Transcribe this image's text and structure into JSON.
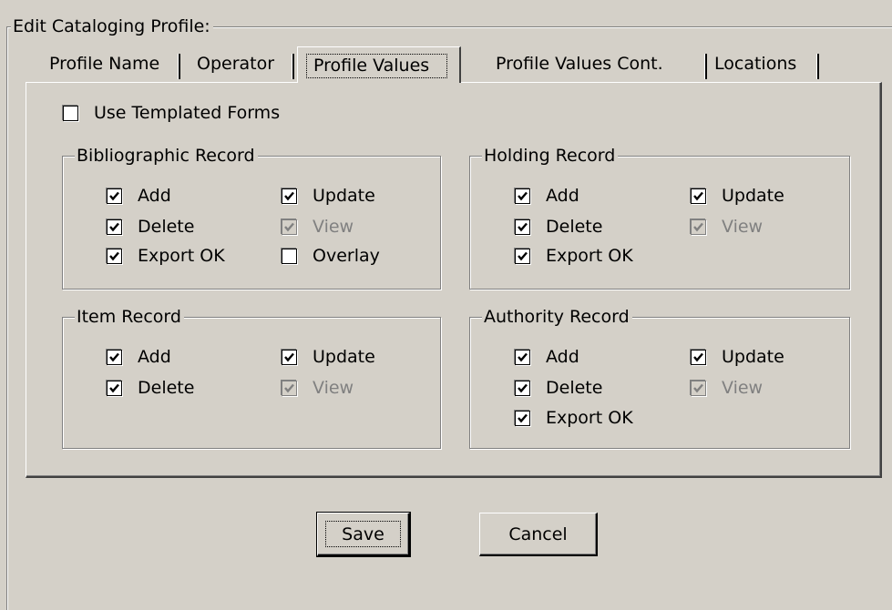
{
  "dialog": {
    "title": "Edit Cataloging Profile:"
  },
  "tabs": [
    {
      "label": "Profile Name",
      "active": false
    },
    {
      "label": "Operator",
      "active": false
    },
    {
      "label": "Profile Values",
      "active": true
    },
    {
      "label": "Profile Values Cont.",
      "active": false
    },
    {
      "label": "Locations",
      "active": false
    }
  ],
  "use_templated_forms": {
    "label": "Use Templated Forms",
    "checked": false
  },
  "groups": {
    "bibliographic": {
      "title": "Bibliographic Record",
      "add": {
        "label": "Add",
        "checked": true
      },
      "update": {
        "label": "Update",
        "checked": true
      },
      "delete": {
        "label": "Delete",
        "checked": true
      },
      "view": {
        "label": "View",
        "checked": true,
        "disabled": true
      },
      "export_ok": {
        "label": "Export OK",
        "checked": true
      },
      "overlay": {
        "label": "Overlay",
        "checked": false
      }
    },
    "holding": {
      "title": "Holding Record",
      "add": {
        "label": "Add",
        "checked": true
      },
      "update": {
        "label": "Update",
        "checked": true
      },
      "delete": {
        "label": "Delete",
        "checked": true
      },
      "view": {
        "label": "View",
        "checked": true,
        "disabled": true
      },
      "export_ok": {
        "label": "Export OK",
        "checked": true
      }
    },
    "item": {
      "title": "Item Record",
      "add": {
        "label": "Add",
        "checked": true
      },
      "update": {
        "label": "Update",
        "checked": true
      },
      "delete": {
        "label": "Delete",
        "checked": true
      },
      "view": {
        "label": "View",
        "checked": true,
        "disabled": true
      }
    },
    "authority": {
      "title": "Authority Record",
      "add": {
        "label": "Add",
        "checked": true
      },
      "update": {
        "label": "Update",
        "checked": true
      },
      "delete": {
        "label": "Delete",
        "checked": true
      },
      "view": {
        "label": "View",
        "checked": true,
        "disabled": true
      },
      "export_ok": {
        "label": "Export OK",
        "checked": true
      }
    }
  },
  "buttons": {
    "save": "Save",
    "cancel": "Cancel"
  },
  "colors": {
    "face": "#d4d0c8",
    "disabled_text": "#808080",
    "shadow": "#808080",
    "highlight": "#ffffff"
  }
}
